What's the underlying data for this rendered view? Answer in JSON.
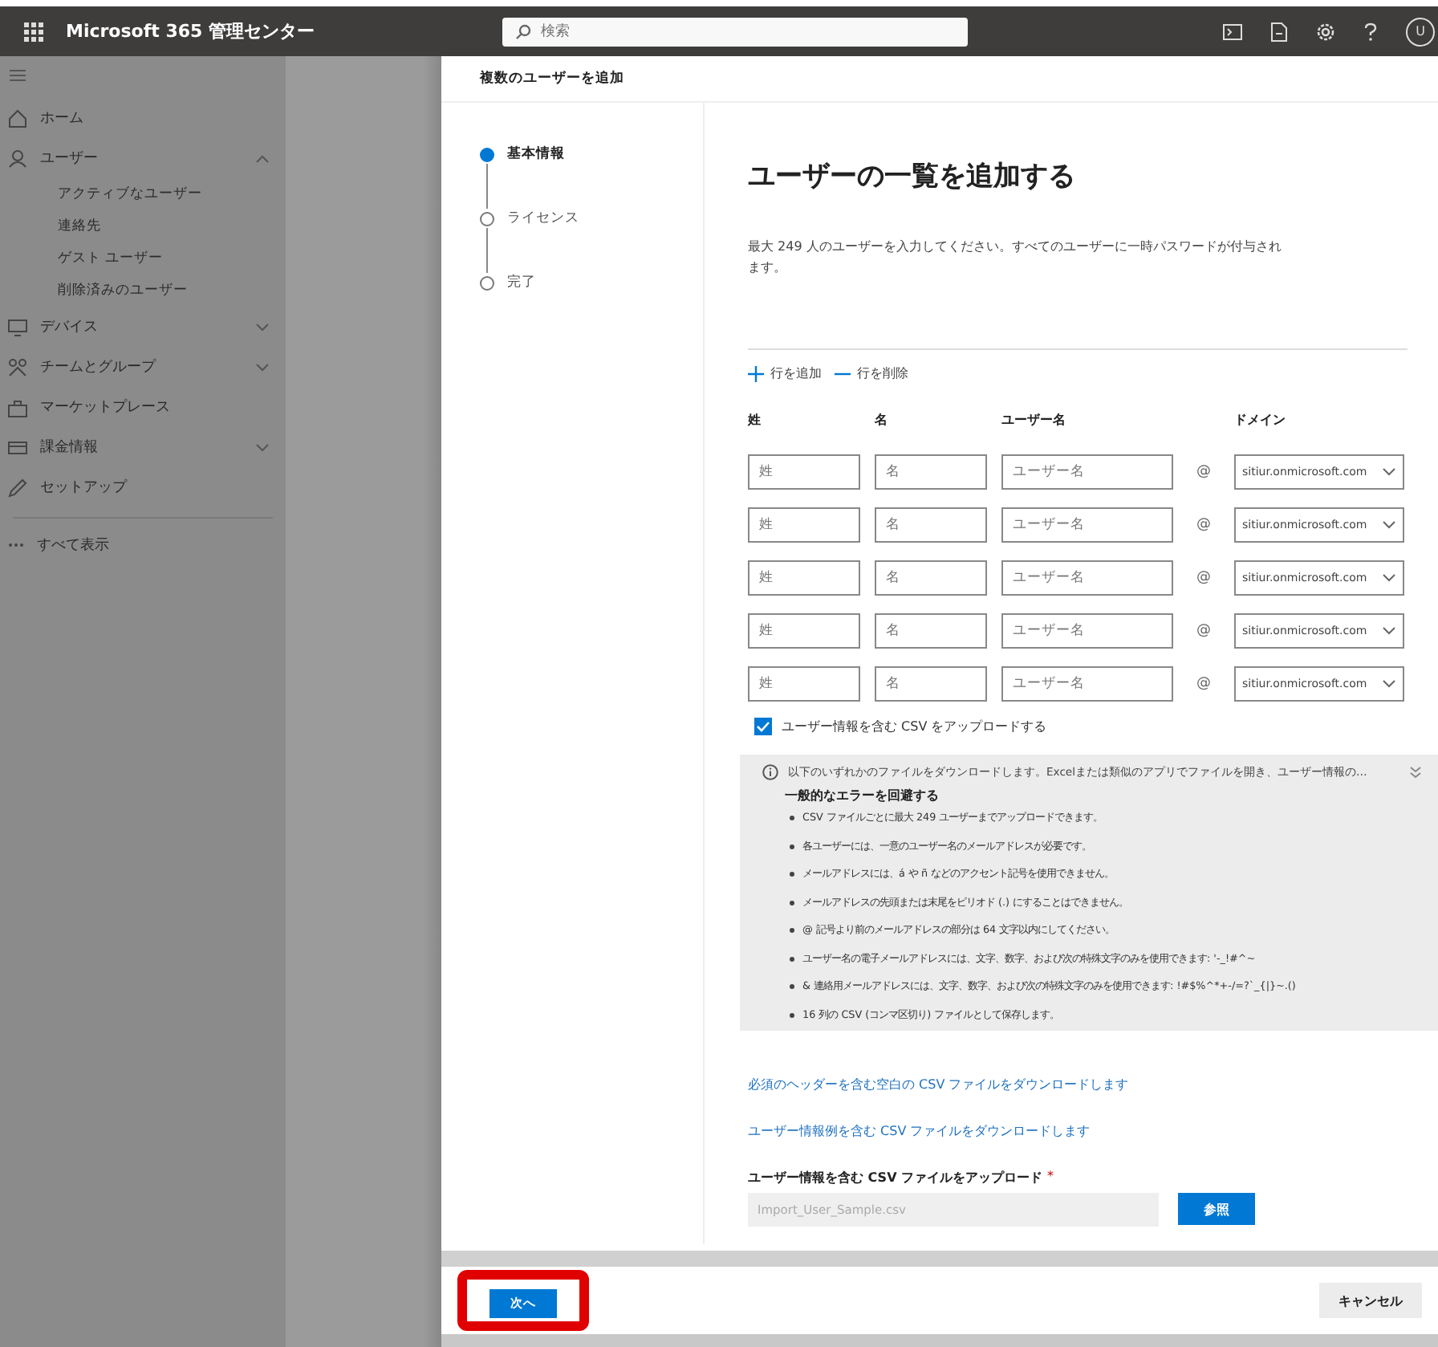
{
  "topbar": {
    "title": "Microsoft 365 管理センター",
    "search_placeholder": "検索",
    "avatar": "U"
  },
  "sidebar": {
    "items": [
      {
        "label": "ホーム",
        "expandable": false
      },
      {
        "label": "ユーザー",
        "expandable": true,
        "expanded": true,
        "children": [
          {
            "label": "アクティブなユーザー"
          },
          {
            "label": "連絡先"
          },
          {
            "label": "ゲスト ユーザー"
          },
          {
            "label": "削除済みのユーザー"
          }
        ]
      },
      {
        "label": "デバイス",
        "expandable": true,
        "expanded": false
      },
      {
        "label": "チームとグループ",
        "expandable": true,
        "expanded": false
      },
      {
        "label": "マーケットプレース",
        "expandable": false
      },
      {
        "label": "課金情報",
        "expandable": true,
        "expanded": false
      },
      {
        "label": "セットアップ",
        "expandable": false
      }
    ],
    "show_all": "すべて表示"
  },
  "panel": {
    "title": "複数のユーザーを追加",
    "steps": [
      {
        "label": "基本情報",
        "selected": true
      },
      {
        "label": "ライセンス",
        "selected": false
      },
      {
        "label": "完了",
        "selected": false
      }
    ],
    "heading": "ユーザーの一覧を追加する",
    "description": "最大 249 人のユーザーを入力してください。すべてのユーザーに一時パスワードが付与されます。",
    "add_row": "行を追加",
    "delete_row": "行を削除",
    "columns": [
      "姓",
      "名",
      "ユーザー名",
      "ドメイン"
    ],
    "rows": [
      {
        "fields": [
          {
            "placeholder": "姓"
          },
          {
            "placeholder": "名"
          },
          {
            "placeholder": "ユーザー名"
          }
        ],
        "at": "@",
        "domain": "sitiur.onmicrosoft.com"
      },
      {
        "fields": [
          {
            "placeholder": "姓"
          },
          {
            "placeholder": "名"
          },
          {
            "placeholder": "ユーザー名"
          }
        ],
        "at": "@",
        "domain": "sitiur.onmicrosoft.com"
      },
      {
        "fields": [
          {
            "placeholder": "姓"
          },
          {
            "placeholder": "名"
          },
          {
            "placeholder": "ユーザー名"
          }
        ],
        "at": "@",
        "domain": "sitiur.onmicrosoft.com"
      },
      {
        "fields": [
          {
            "placeholder": "姓"
          },
          {
            "placeholder": "名"
          },
          {
            "placeholder": "ユーザー名"
          }
        ],
        "at": "@",
        "domain": "sitiur.onmicrosoft.com"
      },
      {
        "fields": [
          {
            "placeholder": "姓"
          },
          {
            "placeholder": "名"
          },
          {
            "placeholder": "ユーザー名"
          }
        ],
        "at": "@",
        "domain": "sitiur.onmicrosoft.com"
      }
    ],
    "csv_checkbox": {
      "label": "ユーザー情報を含む CSV をアップロードする",
      "checked": true
    },
    "info": {
      "summary": "以下のいずれかのファイルをダウンロードします。Excelまたは類似のアプリでファイルを開き、ユーザー情報の…",
      "heading": "一般的なエラーを回避する",
      "bullets": [
        "CSV ファイルごとに最大 249 ユーザーまでアップロードできます。",
        "各ユーザーには、一意のユーザー名のメールアドレスが必要です。",
        "メールアドレスには、á や ñ などのアクセント記号を使用できません。",
        "メールアドレスの先頭または末尾をピリオド (.) にすることはできません。",
        "@ 記号より前のメールアドレスの部分は 64 文字以内にしてください。",
        "ユーザー名の電子メールアドレスには、文字、数字、および次の特殊文字のみを使用できます: '-_!#^~",
        "& 連絡用メールアドレスには、文字、数字、および次の特殊文字のみを使用できます: !#$%^*+-/=?`_{|}~.()",
        "16 列の CSV (コンマ区切り) ファイルとして保存します。"
      ]
    },
    "links": [
      "必須のヘッダーを含む空白の CSV ファイルをダウンロードします",
      "ユーザー情報例を含む CSV ファイルをダウンロードします"
    ],
    "upload": {
      "label": "ユーザー情報を含む CSV ファイルをアップロード",
      "required_mark": "*",
      "value": "Import_User_Sample.csv",
      "browse": "参照"
    },
    "next": {
      "label": "次へ",
      "highlighted": true
    },
    "cancel": "キャンセル"
  }
}
